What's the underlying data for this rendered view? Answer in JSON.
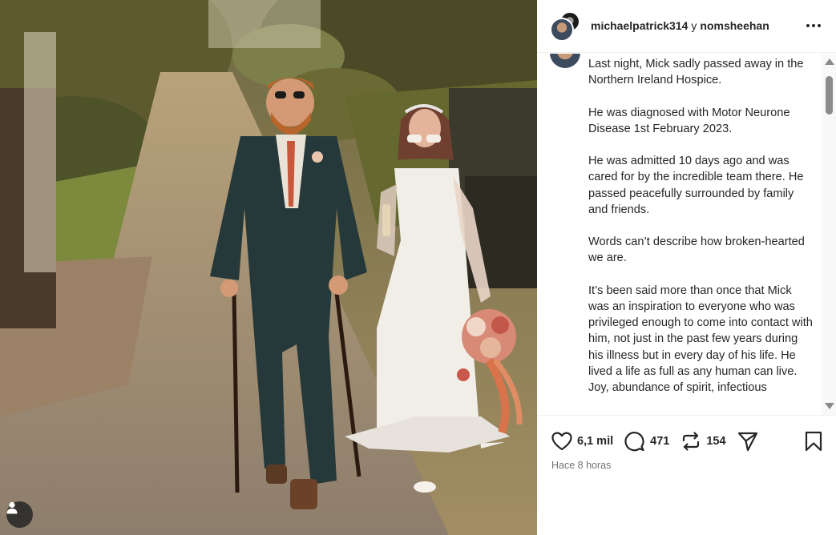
{
  "header": {
    "user1": "michaelpatrick314",
    "conjunction": "y",
    "user2": "nomsheehan"
  },
  "caption": {
    "text": "Last night, Mick sadly passed away in the Northern Ireland Hospice.\n\nHe was diagnosed with Motor Neurone Disease 1st February 2023.\n\nHe was admitted 10 days ago and was cared for by the incredible team there. He passed peacefully surrounded by family and friends.\n\nWords can’t describe how broken-hearted we are.\n\nIt’s been said more than once that Mick was an inspiration to everyone who was privileged enough to come into contact with him, not just in the past few years during his illness but in every day of his life. He lived a life as full as any human can live. Joy, abundance of spirit, infectious"
  },
  "actions": {
    "likes": "6,1 mil",
    "comments": "471",
    "reposts": "154"
  },
  "timestamp": "Hace 8 horas",
  "icons": {
    "more": "more-options-icon",
    "like": "heart-icon",
    "comment": "comment-icon",
    "repost": "repost-icon",
    "share": "share-icon",
    "save": "bookmark-icon",
    "user_tag": "user-tag-icon"
  },
  "colors": {
    "text": "#262626",
    "muted": "#737373",
    "border": "#efefef"
  }
}
